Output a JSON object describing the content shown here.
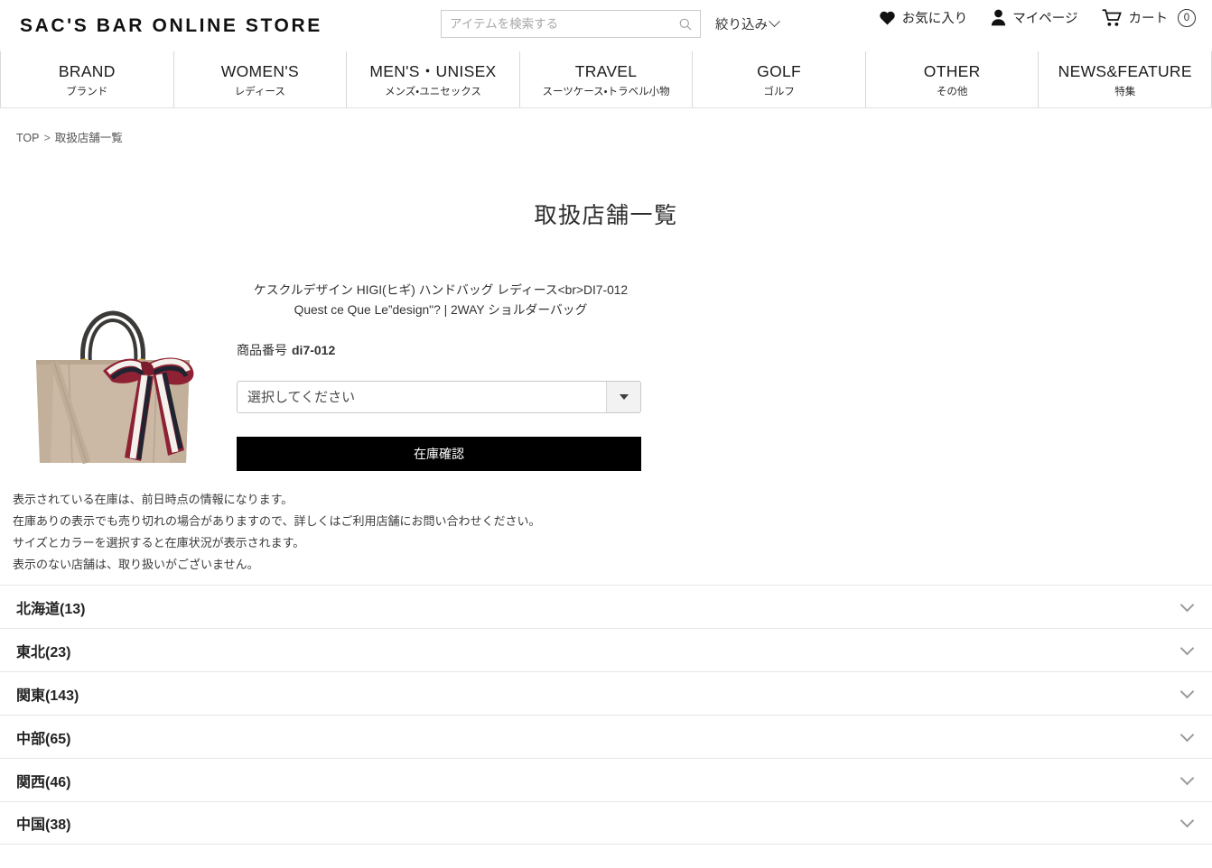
{
  "header": {
    "logo": "SAC'S BAR ONLINE STORE",
    "search": {
      "placeholder": "アイテムを検索する",
      "value": "",
      "icon": "search-icon"
    },
    "filter_label": "絞り込み",
    "utils": [
      {
        "label": "お気に入り",
        "icon": "heart-icon"
      },
      {
        "label": "マイページ",
        "icon": "person-icon"
      },
      {
        "label": "カート",
        "icon": "cart-icon",
        "badge": "0"
      }
    ]
  },
  "nav": {
    "items": [
      {
        "en": "BRAND",
        "ja": "ブランド"
      },
      {
        "en": "WOMEN'S",
        "ja": "レディース"
      },
      {
        "en": "MEN'S・UNISEX",
        "ja": "メンズ・ユニセックス"
      },
      {
        "en": "TRAVEL",
        "ja": "スーツケース・トラベル小物"
      },
      {
        "en": "GOLF",
        "ja": "ゴルフ"
      },
      {
        "en": "OTHER",
        "ja": "その他"
      },
      {
        "en": "NEWS&FEATURE",
        "ja": "特集"
      }
    ]
  },
  "breadcrumb": {
    "top": "TOP",
    "separator": ">",
    "current": "取扱店舗一覧"
  },
  "page": {
    "title": "取扱店舗一覧"
  },
  "product": {
    "name": "ケスクルデザイン HIGI(ヒギ) ハンドバッグ レディース<br>DI7-012 Quest ce Que Le”design\"? | 2WAY ショルダーバッグ",
    "code_label": "商品番号",
    "code_value": "di7-012",
    "image_alt": "handbag-product-image",
    "colors": {
      "bag_body": "#cbb9a5",
      "bag_shadow": "#b5a28d",
      "handle": "#3b3a38",
      "ribbon_red": "#8e2234",
      "ribbon_white": "#f4f1ec",
      "ribbon_navy": "#1f2430",
      "hardware": "#c9a14a"
    }
  },
  "form": {
    "select_value": "選択してください",
    "submit_label": "在庫確認"
  },
  "notes": [
    "表示されている在庫は、前日時点の情報になります。",
    "在庫ありの表示でも売り切れの場合がありますので、詳しくはご利用店舗にお問い合わせください。",
    "サイズとカラーを選択すると在庫状況が表示されます。",
    "表示のない店舗は、取り扱いがございません。"
  ],
  "regions": [
    {
      "label": "北海道(13)",
      "name": "北海道",
      "count": 13
    },
    {
      "label": "東北(23)",
      "name": "東北",
      "count": 23
    },
    {
      "label": "関東(143)",
      "name": "関東",
      "count": 143
    },
    {
      "label": "中部(65)",
      "name": "中部",
      "count": 65
    },
    {
      "label": "関西(46)",
      "name": "関西",
      "count": 46
    },
    {
      "label": "中国(38)",
      "name": "中国",
      "count": 38
    }
  ]
}
